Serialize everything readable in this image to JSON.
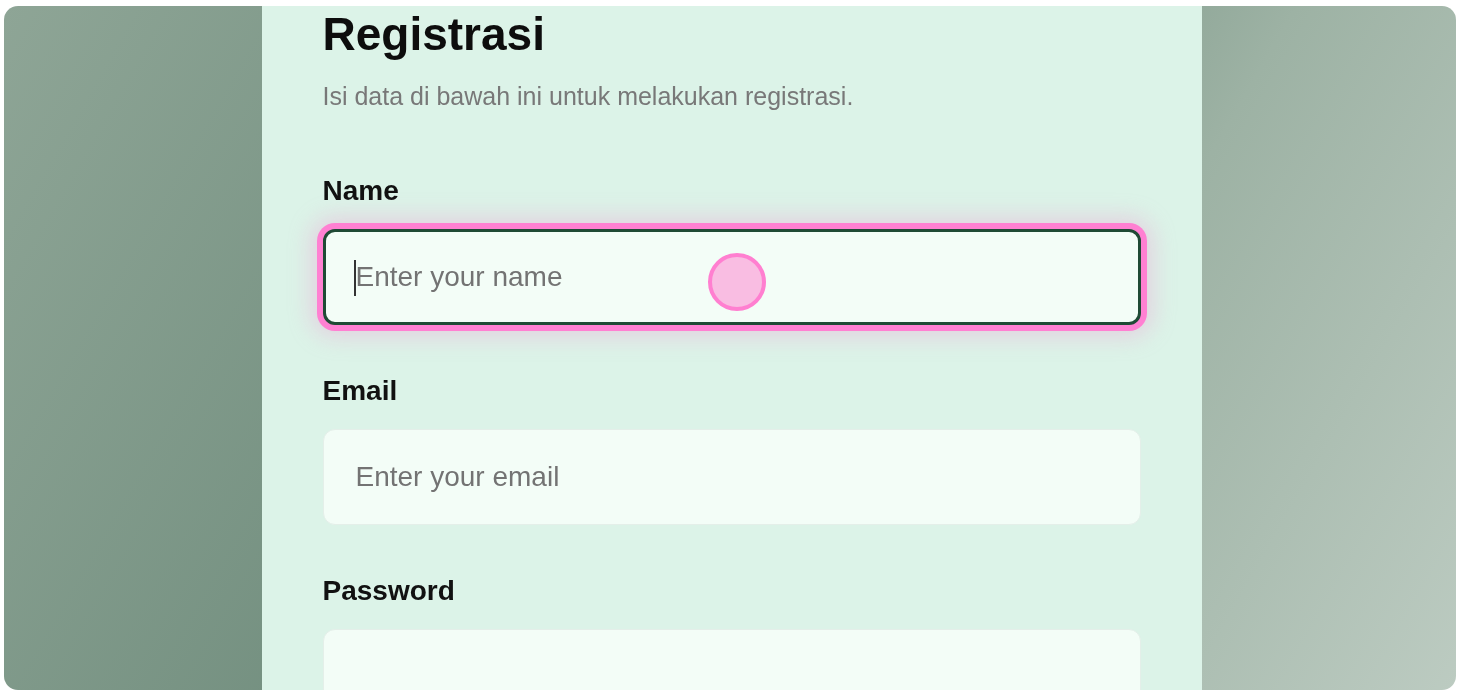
{
  "form": {
    "title": "Registrasi",
    "subtitle": "Isi data di bawah ini untuk melakukan registrasi.",
    "fields": [
      {
        "label": "Name",
        "placeholder": "Enter your name",
        "focused": true,
        "clicked": true
      },
      {
        "label": "Email",
        "placeholder": "Enter your email",
        "focused": false
      },
      {
        "label": "Password",
        "focused": false
      }
    ]
  }
}
